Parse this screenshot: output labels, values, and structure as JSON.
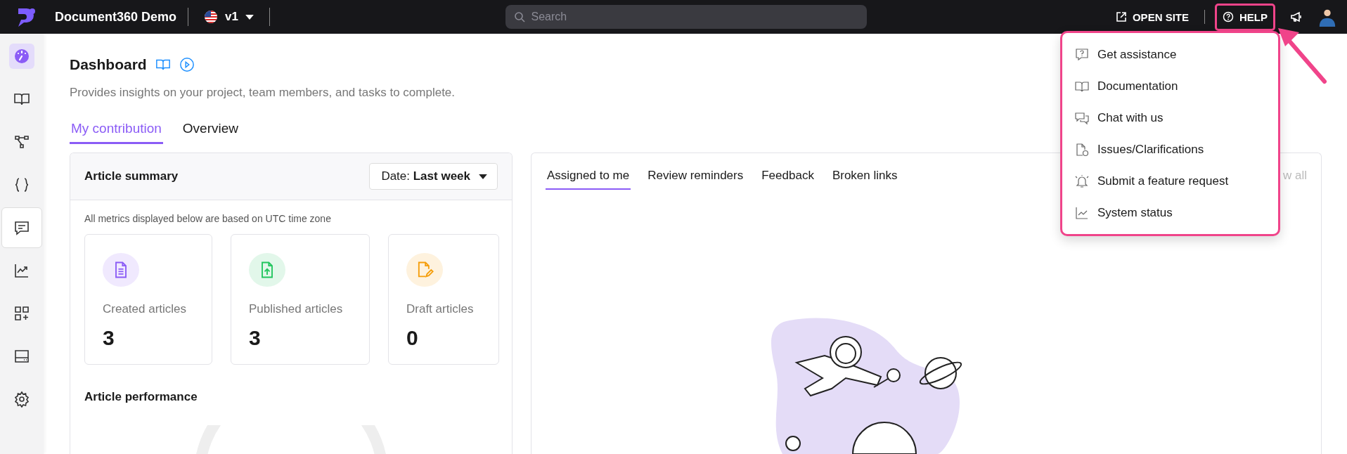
{
  "topbar": {
    "project_name": "Document360 Demo",
    "version": "v1",
    "search_placeholder": "Search",
    "open_site": "OPEN SITE",
    "help": {
      "label": "HELP",
      "highlighted": true
    }
  },
  "sidebar": {
    "items": [
      {
        "kind": "dashboard",
        "selected": true,
        "highlighted": false
      },
      {
        "kind": "book",
        "selected": false,
        "highlighted": false
      },
      {
        "kind": "tree",
        "selected": false,
        "highlighted": false
      },
      {
        "kind": "braces",
        "selected": false,
        "highlighted": false
      },
      {
        "kind": "feedback",
        "selected": false,
        "highlighted": true
      },
      {
        "kind": "analytics",
        "selected": false,
        "highlighted": false
      },
      {
        "kind": "apps",
        "selected": false,
        "highlighted": false
      },
      {
        "kind": "drive",
        "selected": false,
        "highlighted": false
      },
      {
        "kind": "settings",
        "selected": false,
        "highlighted": false
      }
    ]
  },
  "help_menu": {
    "highlighted": true,
    "items": [
      {
        "kind": "question",
        "label": "Get assistance"
      },
      {
        "kind": "book",
        "label": "Documentation"
      },
      {
        "kind": "chat",
        "label": "Chat with us"
      },
      {
        "kind": "issue",
        "label": "Issues/Clarifications"
      },
      {
        "kind": "bell",
        "label": "Submit a feature request"
      },
      {
        "kind": "chart",
        "label": "System status"
      }
    ]
  },
  "page": {
    "title": "Dashboard",
    "subtitle": "Provides insights on your project, team members, and tasks to complete.",
    "tabs": [
      {
        "label": "My contribution",
        "selected": true
      },
      {
        "label": "Overview",
        "selected": false
      }
    ]
  },
  "article_summary": {
    "title": "Article summary",
    "date_filter": {
      "prefix": "Date:",
      "value": "Last week"
    },
    "note": "All metrics displayed below are based on UTC time zone",
    "stats": [
      {
        "kind": "document",
        "label": "Created articles",
        "value": "3",
        "color": "#8b5cf6"
      },
      {
        "kind": "upload",
        "label": "Published articles",
        "value": "3",
        "color": "#22c55e"
      },
      {
        "kind": "edit",
        "label": "Draft articles",
        "value": "0",
        "color": "#f59e0b"
      }
    ],
    "performance_title": "Article performance"
  },
  "tasks": {
    "tabs": [
      {
        "label": "Assigned to me",
        "selected": true
      },
      {
        "label": "Review reminders",
        "selected": false
      },
      {
        "label": "Feedback",
        "selected": false
      },
      {
        "label": "Broken links",
        "selected": false
      }
    ],
    "view_all": "w all"
  }
}
